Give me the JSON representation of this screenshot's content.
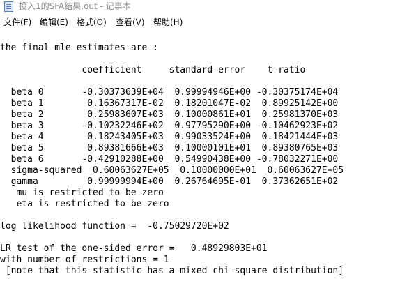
{
  "window": {
    "title": "投入1的SFA结果.out - 记事本"
  },
  "menu": {
    "items": [
      "文件(F)",
      "编辑(E)",
      "格式(O)",
      "查看(V)",
      "帮助(H)"
    ]
  },
  "document": {
    "lines": [
      "the final mle estimates are :",
      "               coefficient     standard-error    t-ratio",
      "  beta 0       -0.30373639E+04  0.99994946E+00 -0.30375174E+04",
      "  beta 1        0.16367317E-02  0.18201047E-02  0.89925142E+00",
      "  beta 2        0.25983607E+03  0.10000861E+01  0.25981370E+03",
      "  beta 3       -0.10232246E+02  0.97795290E+00 -0.10462923E+02",
      "  beta 4        0.18243405E+03  0.99033524E+00  0.18421444E+03",
      "  beta 5        0.89381666E+03  0.10000101E+01  0.89380765E+03",
      "  beta 6       -0.42910288E+00  0.54990438E+00 -0.78032271E+00",
      "  sigma-squared  0.60063627E+05  0.10000000E+01  0.60063627E+05",
      "  gamma         0.99999994E+00  0.26764695E-01  0.37362651E+02",
      "   mu is restricted to be zero",
      "   eta is restricted to be zero",
      "log likelihood function =  -0.75029720E+02",
      "LR test of the one-sided error =   0.48929803E+01",
      "with number of restrictions = 1",
      " [note that this statistic has a mixed chi-square distribution]"
    ]
  }
}
